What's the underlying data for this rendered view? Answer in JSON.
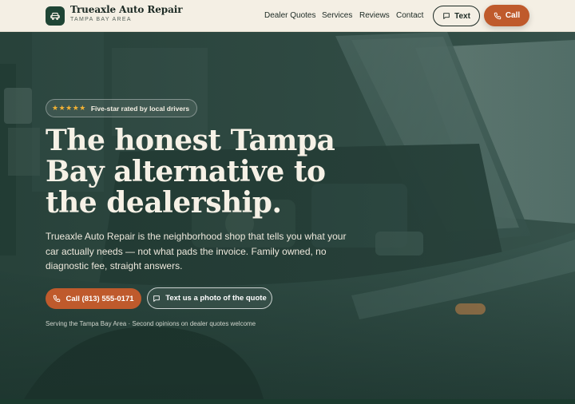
{
  "header": {
    "brand_name": "Trueaxle Auto Repair",
    "brand_sub": "TAMPA BAY AREA",
    "nav": [
      "Dealer Quotes",
      "Services",
      "Reviews",
      "Contact"
    ],
    "text_button": "Text",
    "call_button": "Call"
  },
  "hero": {
    "badge_stars": "★★★★★",
    "badge_text": "Five-star rated by local drivers",
    "headline": "The honest Tampa Bay alternative to the dealership.",
    "subcopy": "Trueaxle Auto Repair is the neighborhood shop that tells you what your car actually needs — not what pads the invoice. Family owned, no diagnostic fee, straight answers.",
    "call_button": "Call (813) 555-0171",
    "text_button": "Text us a photo of the quote",
    "serving_note": "Serving the Tampa Bay Area · Second opinions on dealer quotes welcome"
  },
  "colors": {
    "accent": "#bf5a2c",
    "brand_dark": "#1f4535",
    "header_bg": "#f4efe4",
    "star": "#f2b234"
  },
  "icons": {
    "logo": "car-icon",
    "text": "chat-bubble-icon",
    "call": "phone-icon"
  }
}
